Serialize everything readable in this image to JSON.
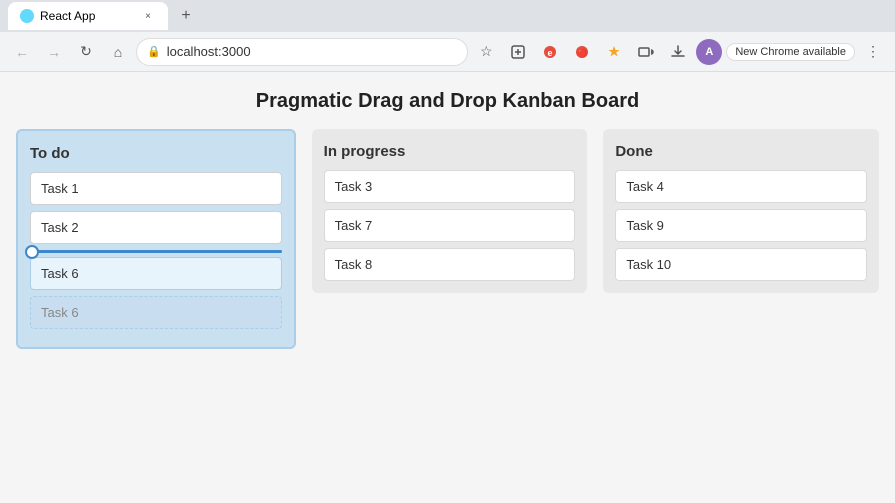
{
  "browser": {
    "tab_label": "React App",
    "tab_close": "×",
    "new_tab": "+",
    "back": "←",
    "forward": "→",
    "reload": "↻",
    "home": "⌂",
    "address": "localhost:3000",
    "lock_icon": "🔒",
    "bookmark_icon": "☆",
    "chrome_available": "New Chrome available",
    "more_icon": "⋮"
  },
  "app": {
    "title": "Pragmatic Drag and Drop Kanban Board",
    "columns": [
      {
        "id": "todo",
        "title": "To do",
        "tasks": [
          {
            "id": "task1",
            "label": "Task 1"
          },
          {
            "id": "task2",
            "label": "Task 2"
          },
          {
            "id": "task6a",
            "label": "Task 6"
          }
        ],
        "dragging": {
          "label": "Task 6"
        }
      },
      {
        "id": "inprogress",
        "title": "In progress",
        "tasks": [
          {
            "id": "task3",
            "label": "Task 3"
          },
          {
            "id": "task7",
            "label": "Task 7"
          },
          {
            "id": "task8",
            "label": "Task 8"
          }
        ]
      },
      {
        "id": "done",
        "title": "Done",
        "tasks": [
          {
            "id": "task4",
            "label": "Task 4"
          },
          {
            "id": "task9",
            "label": "Task 9"
          },
          {
            "id": "task10",
            "label": "Task 10"
          }
        ]
      }
    ]
  }
}
